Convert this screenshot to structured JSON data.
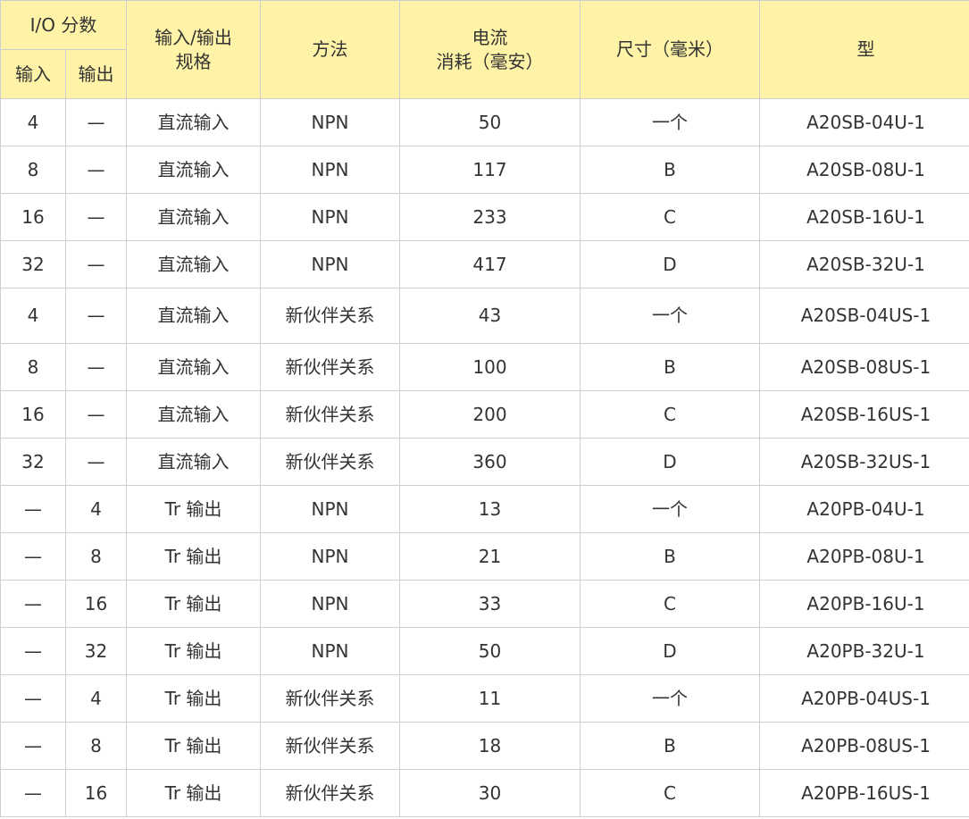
{
  "colors": {
    "header_background": "#fff3a8",
    "border": "#cfcfcf",
    "text": "#333333"
  },
  "header": {
    "io_points": "I/O 分数",
    "input": "输入",
    "output": "输出",
    "io_spec": "输入/输出规格",
    "method": "方法",
    "current_line1": "电流",
    "current_line2": "消耗（毫安）",
    "size": "尺寸（毫米）",
    "model": "型"
  },
  "rows": [
    {
      "input": "4",
      "output": "—",
      "spec": "直流输入",
      "method": "NPN",
      "current": "50",
      "size": "一个",
      "model": "A20SB-04U-1"
    },
    {
      "input": "8",
      "output": "—",
      "spec": "直流输入",
      "method": "NPN",
      "current": "117",
      "size": "B",
      "model": "A20SB-08U-1"
    },
    {
      "input": "16",
      "output": "—",
      "spec": "直流输入",
      "method": "NPN",
      "current": "233",
      "size": "C",
      "model": "A20SB-16U-1"
    },
    {
      "input": "32",
      "output": "—",
      "spec": "直流输入",
      "method": "NPN",
      "current": "417",
      "size": "D",
      "model": "A20SB-32U-1"
    },
    {
      "input": "4",
      "output": "—",
      "spec": "直流输入",
      "method": "新伙伴关系",
      "current": "43",
      "size": "一个",
      "model": "A20SB-04US-1"
    },
    {
      "input": "8",
      "output": "—",
      "spec": "直流输入",
      "method": "新伙伴关系",
      "current": "100",
      "size": "B",
      "model": "A20SB-08US-1"
    },
    {
      "input": "16",
      "output": "—",
      "spec": "直流输入",
      "method": "新伙伴关系",
      "current": "200",
      "size": "C",
      "model": "A20SB-16US-1"
    },
    {
      "input": "32",
      "output": "—",
      "spec": "直流输入",
      "method": "新伙伴关系",
      "current": "360",
      "size": "D",
      "model": "A20SB-32US-1"
    },
    {
      "input": "—",
      "output": "4",
      "spec": "Tr 输出",
      "method": "NPN",
      "current": "13",
      "size": "一个",
      "model": "A20PB-04U-1"
    },
    {
      "input": "—",
      "output": "8",
      "spec": "Tr 输出",
      "method": "NPN",
      "current": "21",
      "size": "B",
      "model": "A20PB-08U-1"
    },
    {
      "input": "—",
      "output": "16",
      "spec": "Tr 输出",
      "method": "NPN",
      "current": "33",
      "size": "C",
      "model": "A20PB-16U-1"
    },
    {
      "input": "—",
      "output": "32",
      "spec": "Tr 输出",
      "method": "NPN",
      "current": "50",
      "size": "D",
      "model": "A20PB-32U-1"
    },
    {
      "input": "—",
      "output": "4",
      "spec": "Tr 输出",
      "method": "新伙伴关系",
      "current": "11",
      "size": "一个",
      "model": "A20PB-04US-1"
    },
    {
      "input": "—",
      "output": "8",
      "spec": "Tr 输出",
      "method": "新伙伴关系",
      "current": "18",
      "size": "B",
      "model": "A20PB-08US-1"
    },
    {
      "input": "—",
      "output": "16",
      "spec": "Tr 输出",
      "method": "新伙伴关系",
      "current": "30",
      "size": "C",
      "model": "A20PB-16US-1"
    }
  ]
}
